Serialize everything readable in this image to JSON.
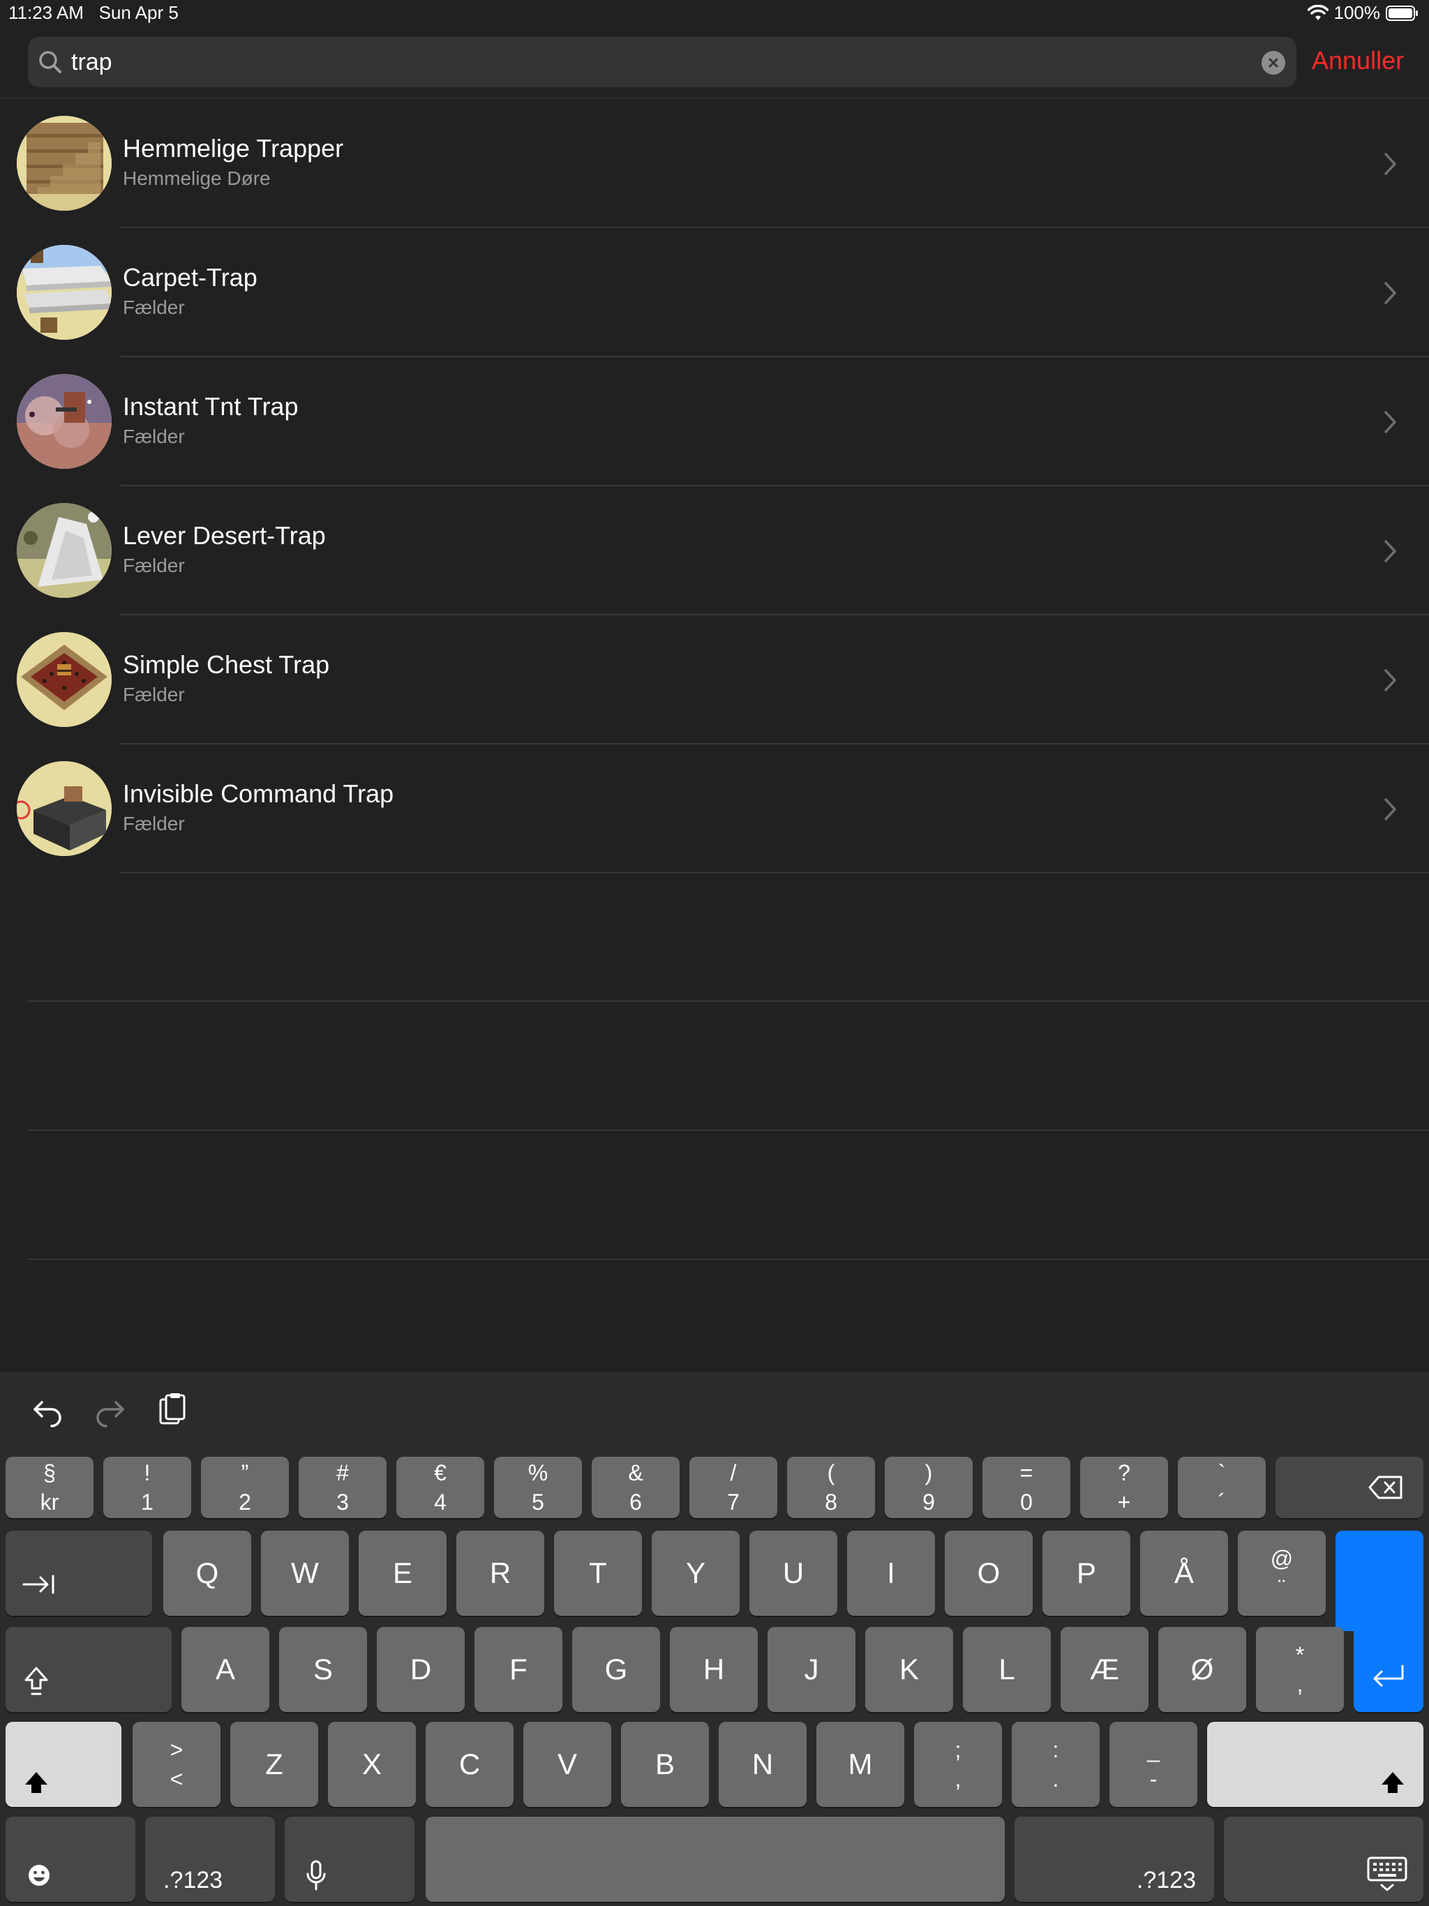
{
  "status_bar": {
    "time": "11:23 AM",
    "date": "Sun Apr 5",
    "battery": "100%"
  },
  "search": {
    "value": "trap",
    "cancel_label": "Annuller"
  },
  "results": [
    {
      "title": "Hemmelige Trapper",
      "subtitle": "Hemmelige Døre",
      "thumb": "stairs"
    },
    {
      "title": "Carpet-Trap",
      "subtitle": "Fælder",
      "thumb": "carpet"
    },
    {
      "title": "Instant Tnt Trap",
      "subtitle": "Fælder",
      "thumb": "tnt"
    },
    {
      "title": "Lever Desert-Trap",
      "subtitle": "Fælder",
      "thumb": "desert"
    },
    {
      "title": "Simple Chest Trap",
      "subtitle": "Fælder",
      "thumb": "chest"
    },
    {
      "title": "Invisible Command Trap",
      "subtitle": "Fælder",
      "thumb": "command"
    }
  ],
  "keyboard": {
    "number_row": [
      {
        "top": "§",
        "bottom": "kr"
      },
      {
        "top": "!",
        "bottom": "1"
      },
      {
        "top": "”",
        "bottom": "2"
      },
      {
        "top": "#",
        "bottom": "3"
      },
      {
        "top": "€",
        "bottom": "4"
      },
      {
        "top": "%",
        "bottom": "5"
      },
      {
        "top": "&",
        "bottom": "6"
      },
      {
        "top": "/",
        "bottom": "7"
      },
      {
        "top": "(",
        "bottom": "8"
      },
      {
        "top": ")",
        "bottom": "9"
      },
      {
        "top": "=",
        "bottom": "0"
      },
      {
        "top": "?",
        "bottom": "+"
      },
      {
        "top": "`",
        "bottom": "´"
      }
    ],
    "row_q": [
      "Q",
      "W",
      "E",
      "R",
      "T",
      "Y",
      "U",
      "I",
      "O",
      "P",
      "Å"
    ],
    "row_q_extra": {
      "top": "@",
      "bottom": "¨"
    },
    "row_a": [
      "A",
      "S",
      "D",
      "F",
      "G",
      "H",
      "J",
      "K",
      "L",
      "Æ",
      "Ø"
    ],
    "row_a_extra": {
      "top": "*",
      "bottom": ","
    },
    "row_z_first": {
      "top": ">",
      "bottom": "<"
    },
    "row_z": [
      "Z",
      "X",
      "C",
      "V",
      "B",
      "N",
      "M"
    ],
    "row_z_punct": [
      {
        "top": ";",
        "bottom": ","
      },
      {
        "top": ":",
        "bottom": "."
      },
      {
        "top": "_",
        "bottom": "-"
      }
    ],
    "numbers_label": ".?123",
    "numbers_label_right": ".?123"
  }
}
